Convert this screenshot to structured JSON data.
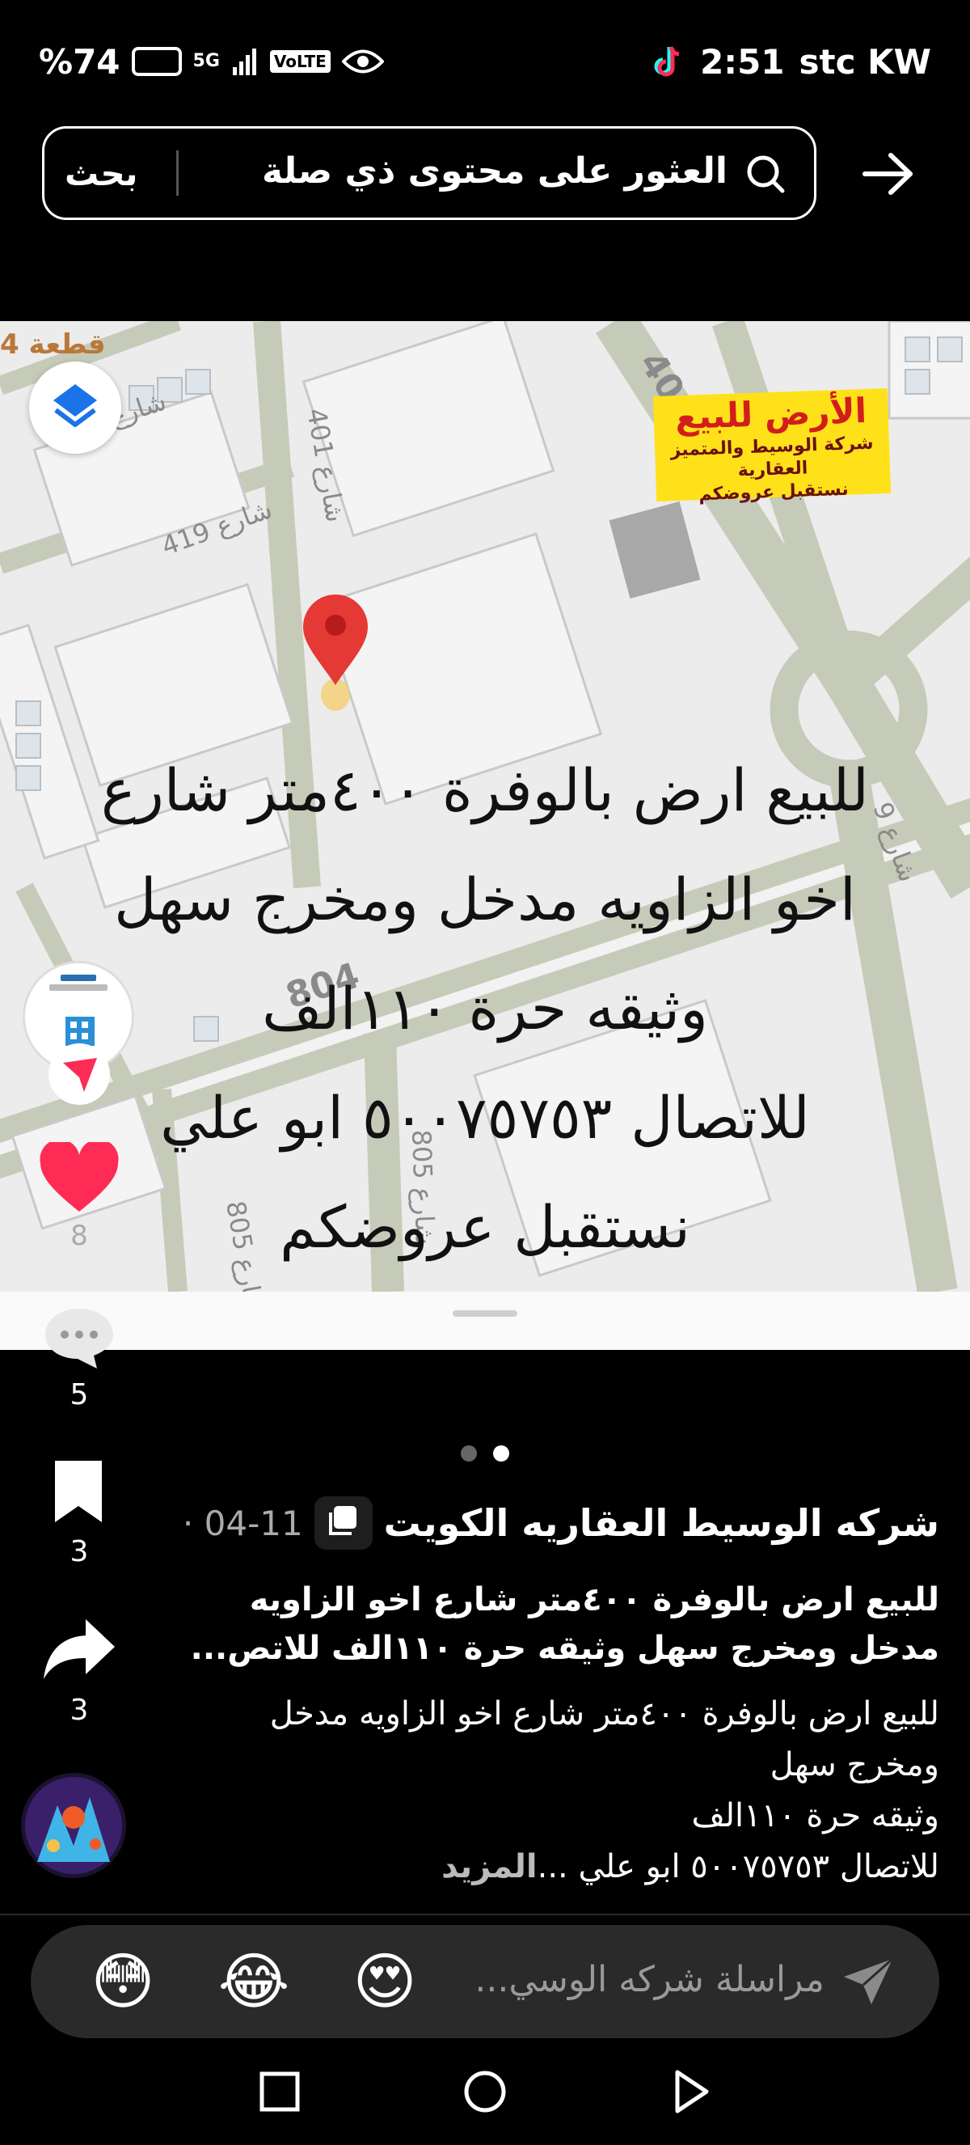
{
  "status_bar": {
    "battery": "%74",
    "network": "5G",
    "volte": "VoLTE",
    "time": "2:51",
    "carrier": "stc KW",
    "icons": [
      "battery-icon",
      "signal-icon",
      "volte-icon",
      "eye-icon",
      "tiktok-icon"
    ]
  },
  "search": {
    "button_label": "بحث",
    "placeholder": "العثور على محتوى ذي صلة"
  },
  "post_image": {
    "sale_badge_title": "الأرض للبيع",
    "sale_badge_company": "شركة الوسيط والمتميز العقارية",
    "sale_badge_tagline": "نستقبل عروضكم",
    "overlay_lines": [
      "للبيع ارض بالوفرة ٤٠٠متر شارع",
      "اخو الزاويه مدخل ومخرج سهل",
      "وثيقه حرة ١١٠الف",
      "للاتصال ٥٠٠٧٥٧٥٣ ابو علي",
      "نستقبل عروضكم"
    ],
    "map_labels": [
      "قطعة 4",
      "شارع 419",
      "شارع 401",
      "804",
      "شارع 805",
      "شارع 805",
      "400",
      "شارع 9"
    ]
  },
  "rail": {
    "likes": "8",
    "comments": "5",
    "bookmarks": "3",
    "shares": "3"
  },
  "caption": {
    "author": "شركه الوسيط العقاريه الكويت",
    "date": "04-11 ·",
    "title_lines": [
      "للبيع ارض بالوفرة ٤٠٠متر شارع اخو الزاويه",
      "مدخل ومخرج سهل  وثيقه حرة ١١٠الف  للاتص..."
    ],
    "body_lines": [
      "للبيع ارض بالوفرة ٤٠٠متر شارع اخو الزاويه مدخل",
      "ومخرج سهل",
      "وثيقه حرة ١١٠الف"
    ],
    "body_last_line": "للاتصال ٥٠٠٧٥٧٥٣ ابو علي ...",
    "more_label": "المزيد"
  },
  "comment_bar": {
    "placeholder": "مراسلة شركه الوسي...",
    "emojis": [
      "😳",
      "😂",
      "😍"
    ]
  },
  "colors": {
    "like": "#fe2c55",
    "pin": "#e53935",
    "badge": "#ffe11a"
  }
}
